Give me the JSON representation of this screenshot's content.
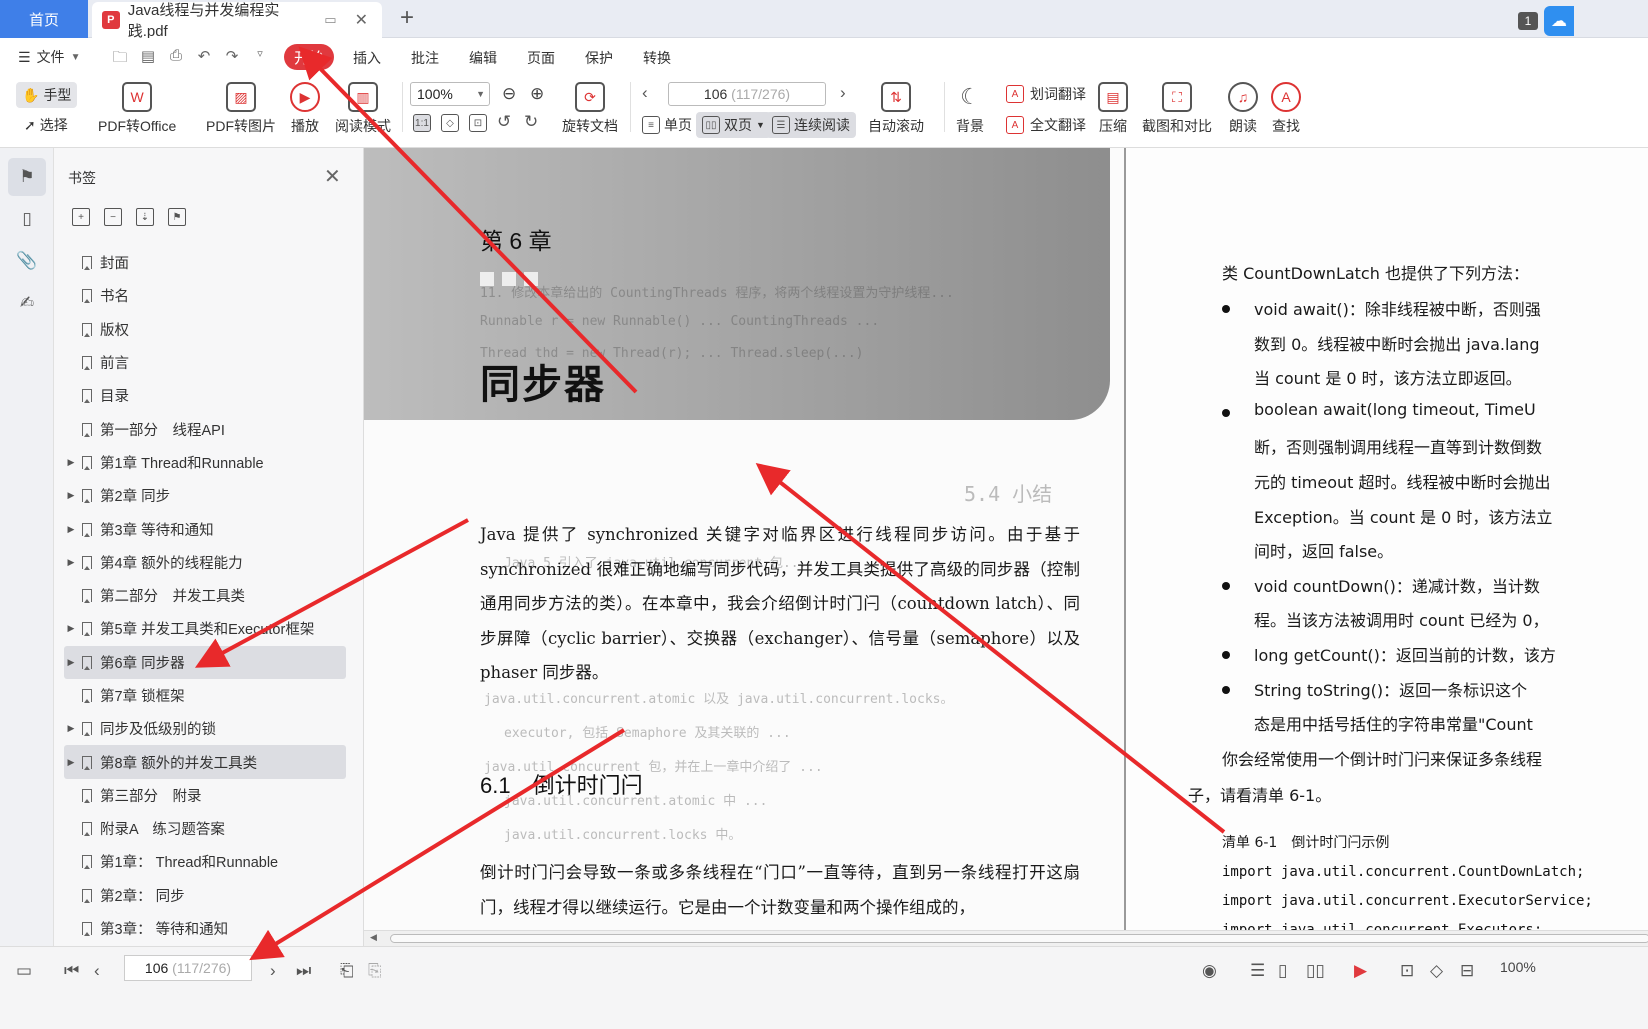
{
  "titlebar": {
    "home_tab": "首页",
    "doc_tab": "Java线程与并发编程实践.pdf",
    "pdf_badge": "P",
    "window_count": "1"
  },
  "menu": {
    "file": "文件",
    "items": [
      "开始",
      "插入",
      "批注",
      "编辑",
      "页面",
      "保护",
      "转换"
    ],
    "active_index": 0
  },
  "toolbar": {
    "hand": "手型",
    "select": "选择",
    "pdf_to_office": "PDF转Office",
    "pdf_to_image": "PDF转图片",
    "play": "播放",
    "read_mode": "阅读模式",
    "zoom": "100%",
    "rotate": "旋转文档",
    "single": "单页",
    "double": "双页",
    "continuous": "连续阅读",
    "page_current": "106",
    "page_total": "(117/276)",
    "auto_scroll": "自动滚动",
    "background": "背景",
    "word_translate": "划词翻译",
    "full_translate": "全文翻译",
    "compress": "压缩",
    "screenshot_compare": "截图和对比",
    "read_aloud": "朗读",
    "find": "查找"
  },
  "bookmarks": {
    "title": "书签",
    "items": [
      {
        "label": "封面",
        "expandable": false
      },
      {
        "label": "书名",
        "expandable": false
      },
      {
        "label": "版权",
        "expandable": false
      },
      {
        "label": "前言",
        "expandable": false
      },
      {
        "label": "目录",
        "expandable": false
      },
      {
        "label": "第一部分　线程API",
        "expandable": false
      },
      {
        "label": "第1章 Thread和Runnable",
        "expandable": true
      },
      {
        "label": "第2章 同步",
        "expandable": true
      },
      {
        "label": "第3章 等待和通知",
        "expandable": true
      },
      {
        "label": "第4章 额外的线程能力",
        "expandable": true
      },
      {
        "label": "第二部分　并发工具类",
        "expandable": false
      },
      {
        "label": "第5章 并发工具类和Executor框架",
        "expandable": true
      },
      {
        "label": "第6章 同步器",
        "expandable": true,
        "highlight": true
      },
      {
        "label": "第7章 锁框架",
        "expandable": false
      },
      {
        "label": "同步及低级别的锁",
        "expandable": true
      },
      {
        "label": "第8章 额外的并发工具类",
        "expandable": true,
        "highlight": true
      },
      {
        "label": "第三部分　附录",
        "expandable": false
      },
      {
        "label": "附录A　练习题答案",
        "expandable": false
      },
      {
        "label": "第1章： Thread和Runnable",
        "expandable": false
      },
      {
        "label": "第2章： 同步",
        "expandable": false
      },
      {
        "label": "第3章： 等待和通知",
        "expandable": false
      }
    ]
  },
  "left_page": {
    "chapter_number": "第 6 章",
    "chapter_title": "同步器",
    "para1": "Java 提供了 synchronized 关键字对临界区进行线程同步访问。由于基于 synchronized 很难正确地编写同步代码，并发工具类提供了高级的同步器（控制通用同步方法的类）。在本章中，我会介绍倒计时门闩（countdown latch）、同步屏障（cyclic barrier）、交换器（exchanger）、信号量（semaphore）以及 phaser 同步器。",
    "section": "6.1　倒计时门闩",
    "para2": "倒计时门闩会导致一条或多条线程在“门口”一直等待，直到另一条线程打开这扇门，线程才得以继续运行。它是由一个计数变量和两个操作组成的，",
    "ghost_lines": [
      "11. 修改本章给出的 CountingThreads 程序，将两个线程设置为守护线程...",
      "Runnable r = new Runnable() ... CountingThreads ...",
      "Thread thd = new Thread(r); ...  Thread.sleep(...)",
      "5.4 小结",
      "Java 5 引入了 java.util.concurrent 包...",
      "java.util.concurrent.atomic 以及 java.util.concurrent.locks。",
      "executor, 包括 Semaphore 及其关联的 ...",
      "java.util.concurrent 包，并在上一章中介绍了 ...",
      "java.util.concurrent.atomic 中 ...",
      "java.util.concurrent.locks 中。"
    ]
  },
  "right_page": {
    "intro": "类 CountDownLatch 也提供了下列方法：",
    "bullets": [
      [
        "void await()：除非线程被中断，否则强",
        "数到 0。线程被中断时会抛出 java.lang",
        "当 count 是 0 时，该方法立即返回。"
      ],
      [
        "boolean await(long timeout, TimeU",
        "断，否则强制调用线程一直等到计数倒数",
        "元的 timeout 超时。线程被中断时会抛出",
        "Exception。当 count 是 0 时，该方法立",
        "间时，返回 false。"
      ],
      [
        "void countDown()：递减计数，当计数",
        "程。当该方法被调用时 count 已经为 0，"
      ],
      [
        "long getCount()：返回当前的计数，该方"
      ],
      [
        "String toString()：返回一条标识这个",
        "态是用中括号括住的字符串常量\"Count"
      ]
    ],
    "para_a": "你会经常使用一个倒计时门闩来保证多条线程",
    "para_b": "子，请看清单 6-1。",
    "listing_title": "清单 6-1　倒计时门闩示例",
    "code": [
      "import java.util.concurrent.CountDownLatch;",
      "import java.util.concurrent.ExecutorService;",
      "import java.util.concurrent.Executors;"
    ]
  },
  "statusbar": {
    "page_current": "106",
    "page_total": "(117/276)",
    "zoom": "100%"
  },
  "colors": {
    "accent": "#e0393e",
    "home_tab": "#3f7fe8",
    "arrow": "#e8292b"
  }
}
